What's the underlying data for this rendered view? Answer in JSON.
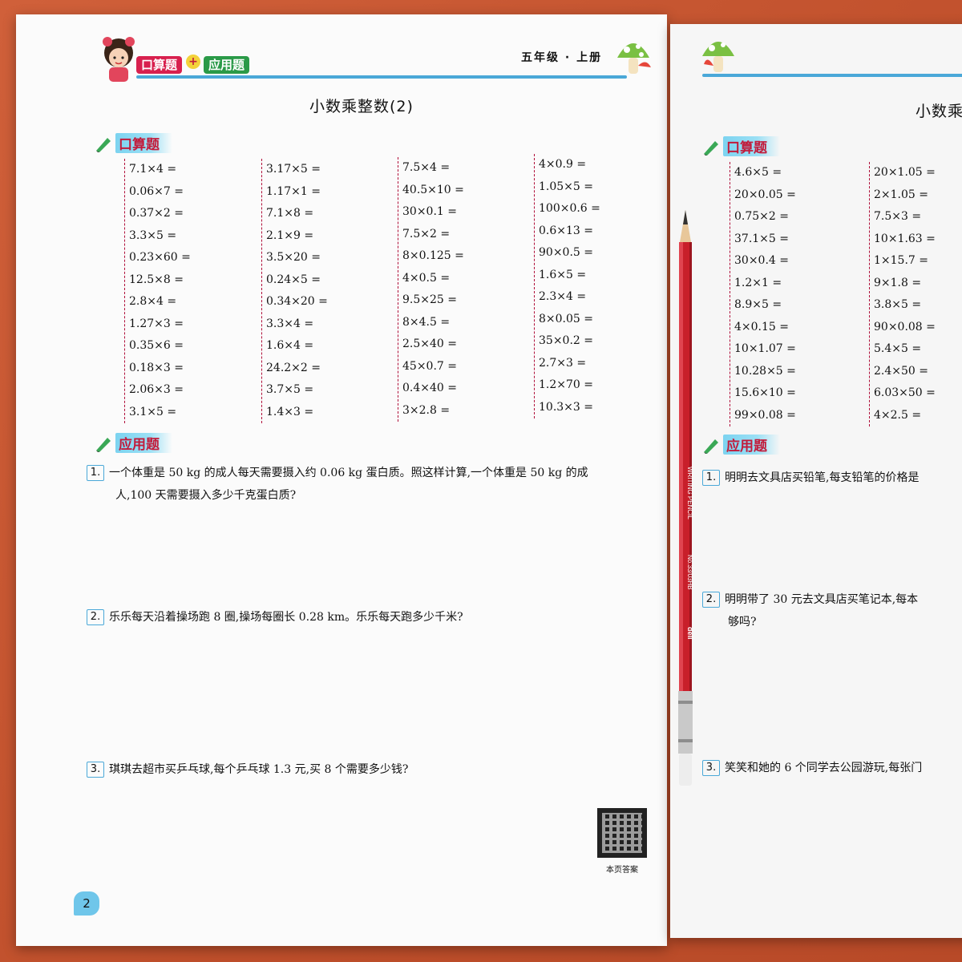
{
  "left_page": {
    "header": {
      "badge_calc": "口算题",
      "plus": "+",
      "badge_app": "应用题",
      "grade": "五年级 · 上册"
    },
    "title": "小数乘整数(2)",
    "section_calc": "口算题",
    "section_app": "应用题",
    "columns": [
      [
        "7.1×4 =",
        "0.06×7 =",
        "0.37×2 =",
        "3.3×5 =",
        "0.23×60 =",
        "12.5×8 =",
        "2.8×4 =",
        "1.27×3 =",
        "0.35×6 =",
        "0.18×3 =",
        "2.06×3 =",
        "3.1×5 ="
      ],
      [
        "3.17×5 =",
        "1.17×1 =",
        "7.1×8 =",
        "2.1×9 =",
        "3.5×20 =",
        "0.24×5 =",
        "0.34×20 =",
        "3.3×4 =",
        "1.6×4 =",
        "24.2×2 =",
        "3.7×5 =",
        "1.4×3 ="
      ],
      [
        "7.5×4 =",
        "40.5×10 =",
        "30×0.1 =",
        "7.5×2 =",
        "8×0.125 =",
        "4×0.5 =",
        "9.5×25 =",
        "8×4.5 =",
        "2.5×40 =",
        "45×0.7 =",
        "0.4×40 =",
        "3×2.8 ="
      ],
      [
        "4×0.9 =",
        "1.05×5 =",
        "100×0.6 =",
        "0.6×13 =",
        "90×0.5 =",
        "1.6×5 =",
        "2.3×4 =",
        "8×0.05 =",
        "35×0.2 =",
        "2.7×3 =",
        "1.2×70 =",
        "10.3×3 ="
      ]
    ],
    "questions": [
      {
        "num": "1.",
        "line1": "一个体重是 50 kg 的成人每天需要摄入约 0.06 kg 蛋白质。照这样计算,一个体重是 50 kg 的成",
        "line2": "人,100 天需要摄入多少千克蛋白质?"
      },
      {
        "num": "2.",
        "line1": "乐乐每天沿着操场跑 8 圈,操场每圈长 0.28 km。乐乐每天跑多少千米?"
      },
      {
        "num": "3.",
        "line1": "琪琪去超市买乒乓球,每个乒乓球 1.3 元,买 8 个需要多少钱?"
      }
    ],
    "qr_caption": "本页答案",
    "page_number": "2"
  },
  "right_page": {
    "title": "小数乘",
    "section_calc": "口算题",
    "section_app": "应用题",
    "columns": [
      [
        "4.6×5 =",
        "20×0.05 =",
        "0.75×2 =",
        "37.1×5 =",
        "30×0.4 =",
        "1.2×1 =",
        "8.9×5 =",
        "4×0.15 =",
        "10×1.07 =",
        "10.28×5 =",
        "15.6×10 =",
        "99×0.08 ="
      ],
      [
        "20×1.05 =",
        "2×1.05 =",
        "7.5×3 =",
        "10×1.63 =",
        "1×15.7 =",
        "9×1.8 =",
        "3.8×5 =",
        "90×0.08 =",
        "5.4×5 =",
        "2.4×50 =",
        "6.03×50 =",
        "4×2.5 ="
      ]
    ],
    "questions": [
      {
        "num": "1.",
        "line1": "明明去文具店买铅笔,每支铅笔的价格是"
      },
      {
        "num": "2.",
        "line1": "明明带了 30 元去文具店买笔记本,每本",
        "line2": "够吗?"
      },
      {
        "num": "3.",
        "line1": "笑笑和她的 6 个同学去公园游玩,每张门"
      }
    ]
  },
  "pencil": {
    "brand_text": "WRITING PENCIL",
    "model_text": "No.33/03HB",
    "logo": "deli"
  },
  "colors": {
    "background": "#c8552f",
    "accent_blue": "#4aa8d8",
    "section_red": "#c21b3b",
    "pencil_red": "#c81f2a"
  }
}
